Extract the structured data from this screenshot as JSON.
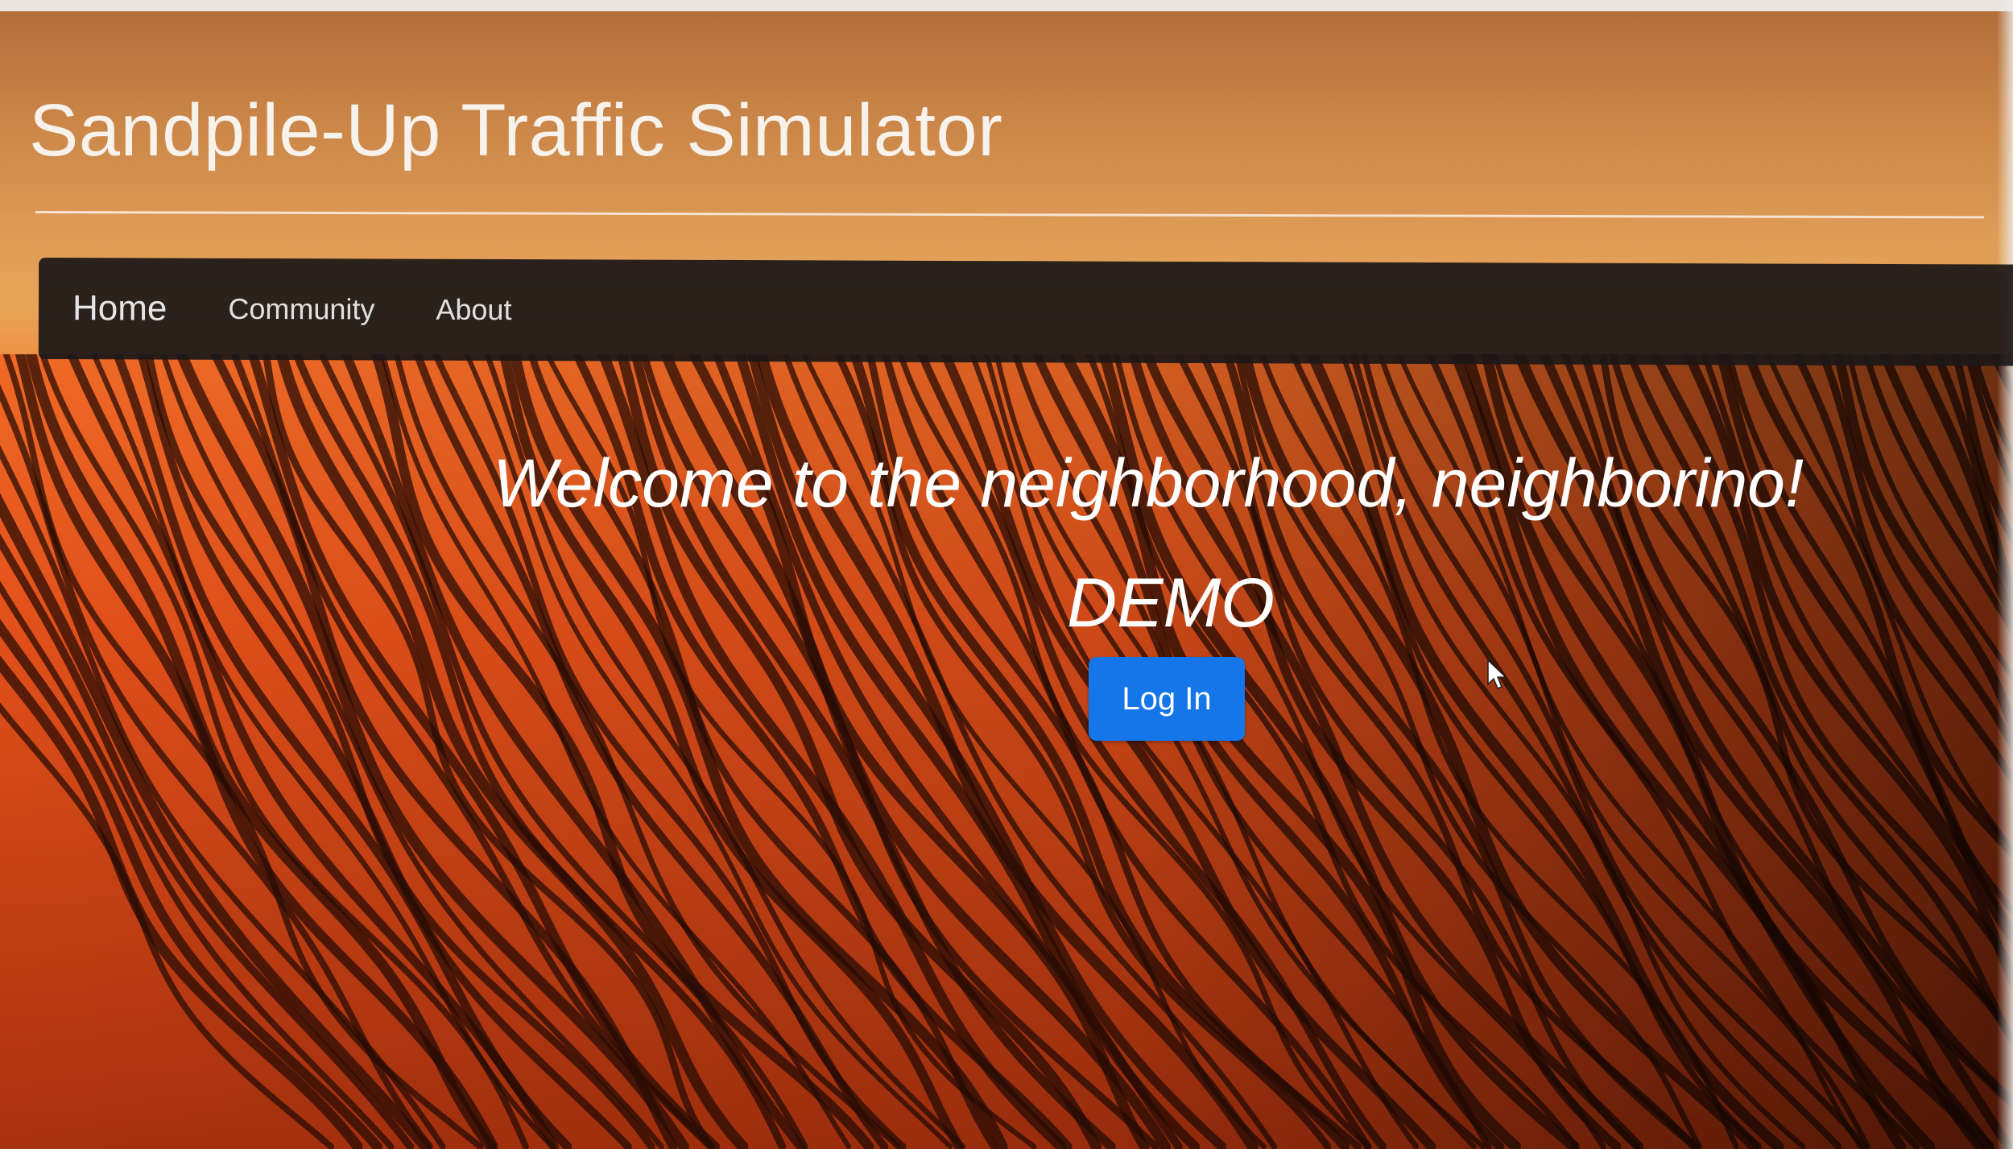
{
  "header": {
    "site_title": "Sandpile-Up Traffic Simulator"
  },
  "navbar": {
    "brand": "Home",
    "links": [
      {
        "label": "Community"
      },
      {
        "label": "About"
      }
    ]
  },
  "hero": {
    "welcome_text": "Welcome to the neighborhood, neighborino!",
    "subtitle": "DEMO",
    "login_label": "Log In"
  },
  "colors": {
    "primary_button": "#1476e8",
    "navbar_bg": "#1c1818",
    "sand_accent": "#ef5a1c"
  },
  "icons": {
    "cursor": "mouse-pointer-icon"
  }
}
